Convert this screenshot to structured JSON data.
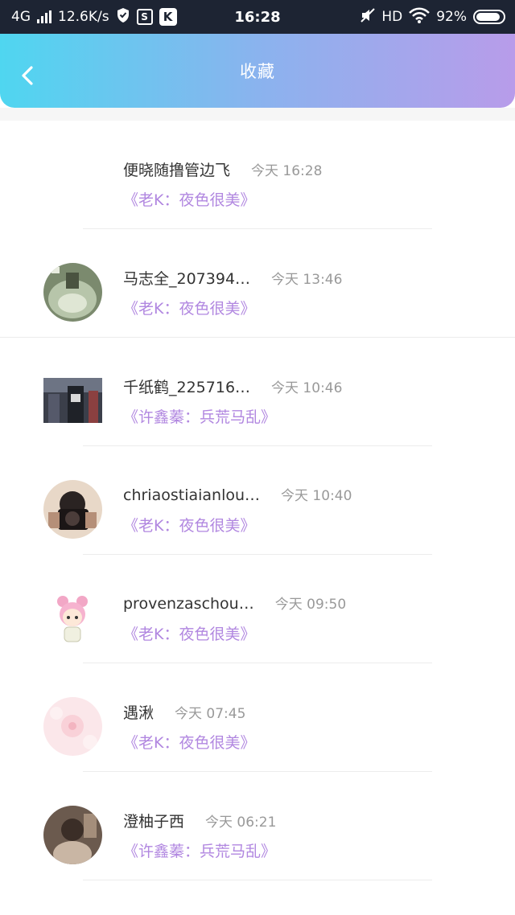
{
  "status_bar": {
    "network": "4G",
    "speed": "12.6K/s",
    "time": "16:28",
    "hd": "HD",
    "battery": "92%",
    "battery_level": 0.92
  },
  "header": {
    "title": "收藏",
    "colors": {
      "start": "#4fd6f0",
      "end": "#b89cea"
    }
  },
  "accent_color": "#b187e0",
  "items": [
    {
      "name": "便晓随撸管边飞",
      "time": "今天 16:28",
      "book": "《老K：夜色很美》",
      "avatar": "none"
    },
    {
      "name": "马志全_207394…",
      "time": "今天 13:46",
      "book": "《老K：夜色很美》",
      "avatar": "photo-green"
    },
    {
      "name": "千纸鹤_225716…",
      "time": "今天 10:46",
      "book": "《许鑫蓁：兵荒马乱》",
      "avatar": "photo-street"
    },
    {
      "name": "chriaostiaianlou…",
      "time": "今天 10:40",
      "book": "《老K：夜色很美》",
      "avatar": "photo-camera"
    },
    {
      "name": "provenzaschou…",
      "time": "今天 09:50",
      "book": "《老K：夜色很美》",
      "avatar": "cartoon-girl"
    },
    {
      "name": "遇湫",
      "time": "今天 07:45",
      "book": "《老K：夜色很美》",
      "avatar": "photo-flower"
    },
    {
      "name": "澄柚子西",
      "time": "今天 06:21",
      "book": "《许鑫蓁：兵荒马乱》",
      "avatar": "photo-portrait"
    }
  ]
}
